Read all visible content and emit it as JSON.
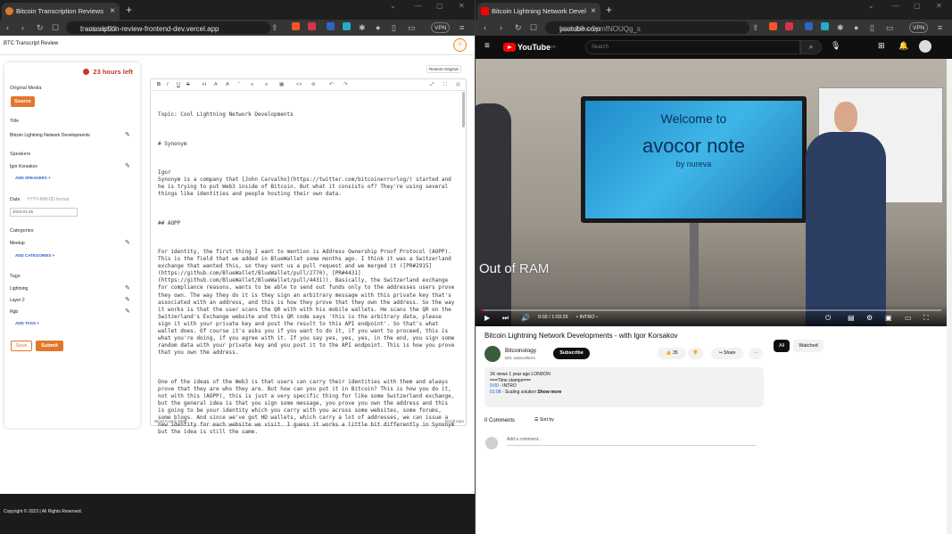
{
  "left_browser": {
    "tab_title": "Bitcoin Transcription Reviews",
    "url_main": "transcription-review-frontend-dev.vercel.app",
    "url_path": "/reviews/23",
    "vpn": "VPN"
  },
  "right_browser": {
    "tab_title": "Bitcoin Lightning Network Devel",
    "url_main": "youtube.com",
    "url_path": "/watch?v=5pmfNOUQg_s",
    "vpn": "VPN"
  },
  "app": {
    "title": "BTC Transcript Review",
    "hours_left": "23 hours left",
    "restore_label": "Restore Original",
    "original_media_label": "Original Media",
    "source_button": "Source",
    "title_label": "Title",
    "title_value": "Bitcoin Lightning Network Developments",
    "speakers_label": "Speakers",
    "speaker_value": "Igor Korsakov",
    "add_speakers": "ADD SPEAKERS +",
    "date_label": "Date",
    "date_placeholder": "YYYY-MM-DD format",
    "date_value": "2023-01-26",
    "categories_label": "Categories",
    "category_value": "Meetup",
    "add_categories": "ADD CATEGORIES +",
    "tags_label": "Tags",
    "tags": [
      "Lightning",
      "Layer 2",
      "Rgb"
    ],
    "add_tags": "ADD TAGS +",
    "save_button": "Save",
    "submit_button": "Submit",
    "word_count": "Word Count: 6564",
    "scroll_auto": "Scroll Auto",
    "footer": "Copyright © 2023  |  All Rights Reserved."
  },
  "editor": {
    "toolbar": [
      "B",
      "I",
      "U",
      "S",
      "H",
      "A",
      "A",
      "“",
      "≡",
      "≡",
      "▦",
      "<>",
      "⊘",
      "↶",
      "↷",
      "⤢",
      "⛶",
      "◎"
    ],
    "paragraphs": [
      "Topic: Cool Lightning Network Developments",
      "# Synonym",
      "Igor\nSynonym is a company that [John Carvalho](https://twitter.com/bitcoinerrorlog/) started and he is trying to put Web3 inside of Bitcoin. But what it consists of? They're using several things like identities and people hosting their own data.",
      "## AOPP",
      "For identity, the first thing I want to mention is Address Ownership Proof Protocol (AOPP). This is the field that we added in BlueWallet some months ago. I think it was a Switzerland exchange that wanted this, so they sent us a pull request and we merged it ([PR#2915](https://github.com/BlueWallet/BlueWallet/pull/2770), [PR#4431](https://github.com/BlueWallet/BlueWallet/pull/4431)). Basically, the Switzerland exchange for compliance reasons, wants to be able to send out funds only to the addresses users prove they own. The way they do it is they sign an arbitrary message with this private key that's associated with an address, and this is how they prove that they own the address. So the way it works is that the user scans the QR with with his mobile wallets. He scans the QR on the Switzerland's Exchange website and this QR code says 'this is the arbitrary data, please sign it with your private key and post the result to this API endpoint'. So that's what wallet does. Of course it's asks you if you want to do it, if you want to proceed, this is what you're doing, if you agree with it. If you say yes, yes, yes, in the end, you sign some random data with your private key and you post it to the API endpoint. This is how you prove that you own the address.",
      "One of the ideas of the Web3 is that users can carry their identities with them and always prove that they are who they are. But how can you put it in Bitcoin? This is how you do it, not with this (AOPP), this is just a very specific thing for like some Switzerland exchange, but the general idea is that you sign some message, you prove you own the address and this is going to be your identity which you carry with you across some websites, some forums, some blogs. And since we've got HD wallets, which carry a lot of addresses, we can issue a new identity for each website we visit. I guess it works a little bit differently in Synonym but the idea is still the same."
    ]
  },
  "youtube": {
    "logo": "YouTube",
    "region": "CA",
    "search_placeholder": "Search",
    "video_screen_line1": "Welcome to",
    "video_screen_line2": "avocor note",
    "video_screen_line3": "by nureva",
    "video_overlay": "Out of RAM",
    "time": "0:02 / 1:03:25",
    "chapter": "• INTRO ›",
    "progress_fraction": 0.001,
    "video_title": "Bitcoin Lightning Network Developments - with Igor Korsakov",
    "channel": "Bitcoinology",
    "subscribers": "501 subscribers",
    "subscribe": "Subscribe",
    "likes": "35",
    "share": "Share",
    "chip_all": "All",
    "chip_watched": "Watched",
    "desc_meta": "1K views  1 year ago  LONDON",
    "desc_line1": "===Time stamps===",
    "desc_ts1": "0:00",
    "desc_ts1_label": " - INTRO",
    "desc_ts2": "01:08",
    "desc_ts2_label": " - Scaling solution",
    "show_more": "Show more",
    "comments": "0 Comments",
    "sort_by": "Sort by",
    "add_comment": "Add a comment..."
  }
}
